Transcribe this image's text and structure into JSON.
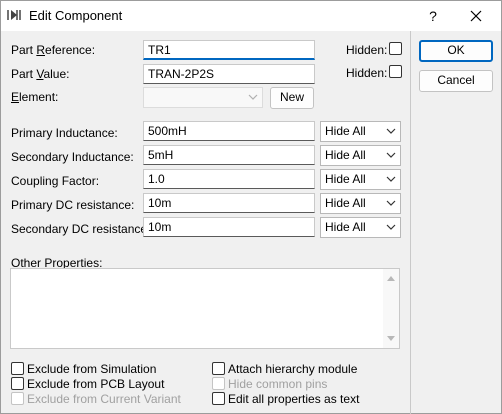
{
  "window": {
    "title": "Edit Component",
    "help": "?",
    "close": "✕"
  },
  "fields": {
    "part_reference": {
      "label_pre": "Part ",
      "label_u": "R",
      "label_post": "eference:",
      "value": "TR1",
      "hidden_label": "Hidden:"
    },
    "part_value": {
      "label_pre": "Part ",
      "label_u": "V",
      "label_post": "alue:",
      "value": "TRAN-2P2S",
      "hidden_label": "Hidden:"
    },
    "element": {
      "label_u": "E",
      "label_post": "lement:",
      "value": "",
      "new_button": "New"
    }
  },
  "properties": [
    {
      "label": "Primary Inductance:",
      "value": "500mH",
      "visibility": "Hide All"
    },
    {
      "label": "Secondary Inductance:",
      "value": "5mH",
      "visibility": "Hide All"
    },
    {
      "label": "Coupling Factor:",
      "value": "1.0",
      "visibility": "Hide All"
    },
    {
      "label": "Primary DC resistance:",
      "value": "10m",
      "visibility": "Hide All"
    },
    {
      "label": "Secondary DC resistance:",
      "value": "10m",
      "visibility": "Hide All"
    }
  ],
  "other_properties": {
    "label_pre": "Other ",
    "label_u": "P",
    "label_post": "roperties:",
    "value": ""
  },
  "options": {
    "exclude_simulation": "Exclude from Simulation",
    "exclude_pcb": "Exclude from PCB Layout",
    "exclude_variant": "Exclude from Current Variant",
    "attach_hierarchy": "Attach hierarchy module",
    "hide_common_pins": "Hide common pins",
    "edit_as_text": "Edit all properties as text"
  },
  "buttons": {
    "ok": "OK",
    "cancel": "Cancel"
  },
  "colors": {
    "accent": "#0067c0",
    "background": "#f0f0f0",
    "disabled_text": "#a0a0a0"
  }
}
